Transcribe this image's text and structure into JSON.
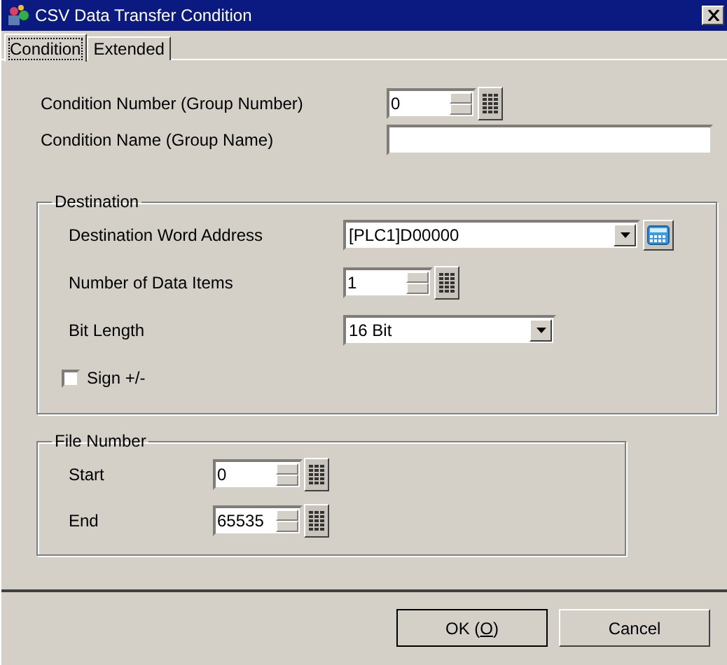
{
  "window": {
    "title": "CSV Data Transfer Condition"
  },
  "tabs": [
    {
      "label": "Condition",
      "selected": true
    },
    {
      "label": "Extended",
      "selected": false
    }
  ],
  "condition_number": {
    "label": "Condition Number (Group Number)",
    "value": "0"
  },
  "condition_name": {
    "label": "Condition Name (Group Name)"
  },
  "destination": {
    "title": "Destination",
    "word_address": {
      "label": "Destination Word Address",
      "value": "[PLC1]D00000"
    },
    "data_items": {
      "label": "Number of Data Items",
      "value": "1"
    },
    "bit_length": {
      "label": "Bit Length",
      "value": "16 Bit"
    },
    "sign": {
      "label": "Sign +/-",
      "checked": false
    }
  },
  "file_number": {
    "title": "File Number",
    "start": {
      "label": "Start",
      "value": "0"
    },
    "end": {
      "label": "End",
      "value": "65535"
    }
  },
  "buttons": [
    {
      "text": "OK (",
      "mnemonic": "O",
      "after": ")",
      "default": true
    },
    {
      "text": "Cancel",
      "default": false
    }
  ]
}
